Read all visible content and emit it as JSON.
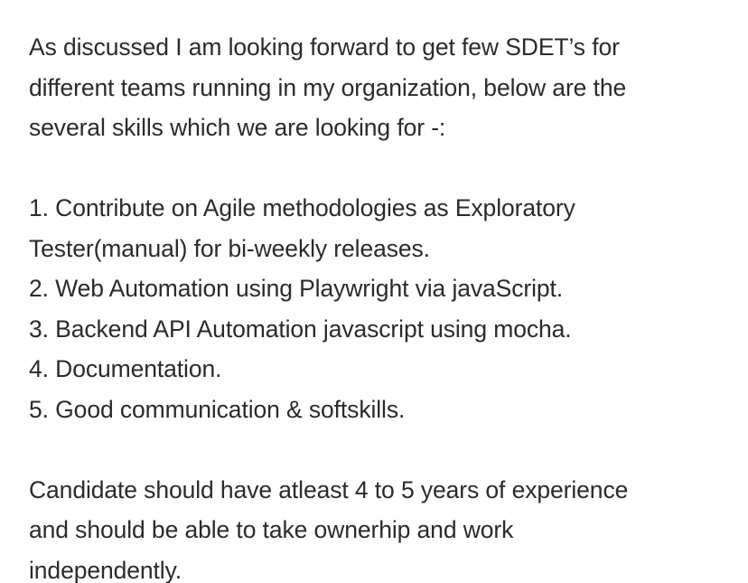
{
  "message": {
    "intro_lines": [
      "As discussed I am looking forward to get few SDET’s for",
      "different teams running in my organization, below are the",
      "several skills which we are looking for -:"
    ],
    "skills": [
      {
        "line1": "1. Contribute on Agile methodologies as Exploratory",
        "line2": "Tester(manual) for bi-weekly releases."
      },
      {
        "line1": "2. Web Automation using Playwright via javaScript."
      },
      {
        "line1": "3. Backend API Automation javascript using mocha."
      },
      {
        "line1": "4. Documentation."
      },
      {
        "line1": "5. Good communication & softskills."
      }
    ],
    "closing_lines": [
      "Candidate should have atleast 4 to 5 years of experience",
      "and should be able to take ownerhip and work",
      "independently."
    ]
  }
}
